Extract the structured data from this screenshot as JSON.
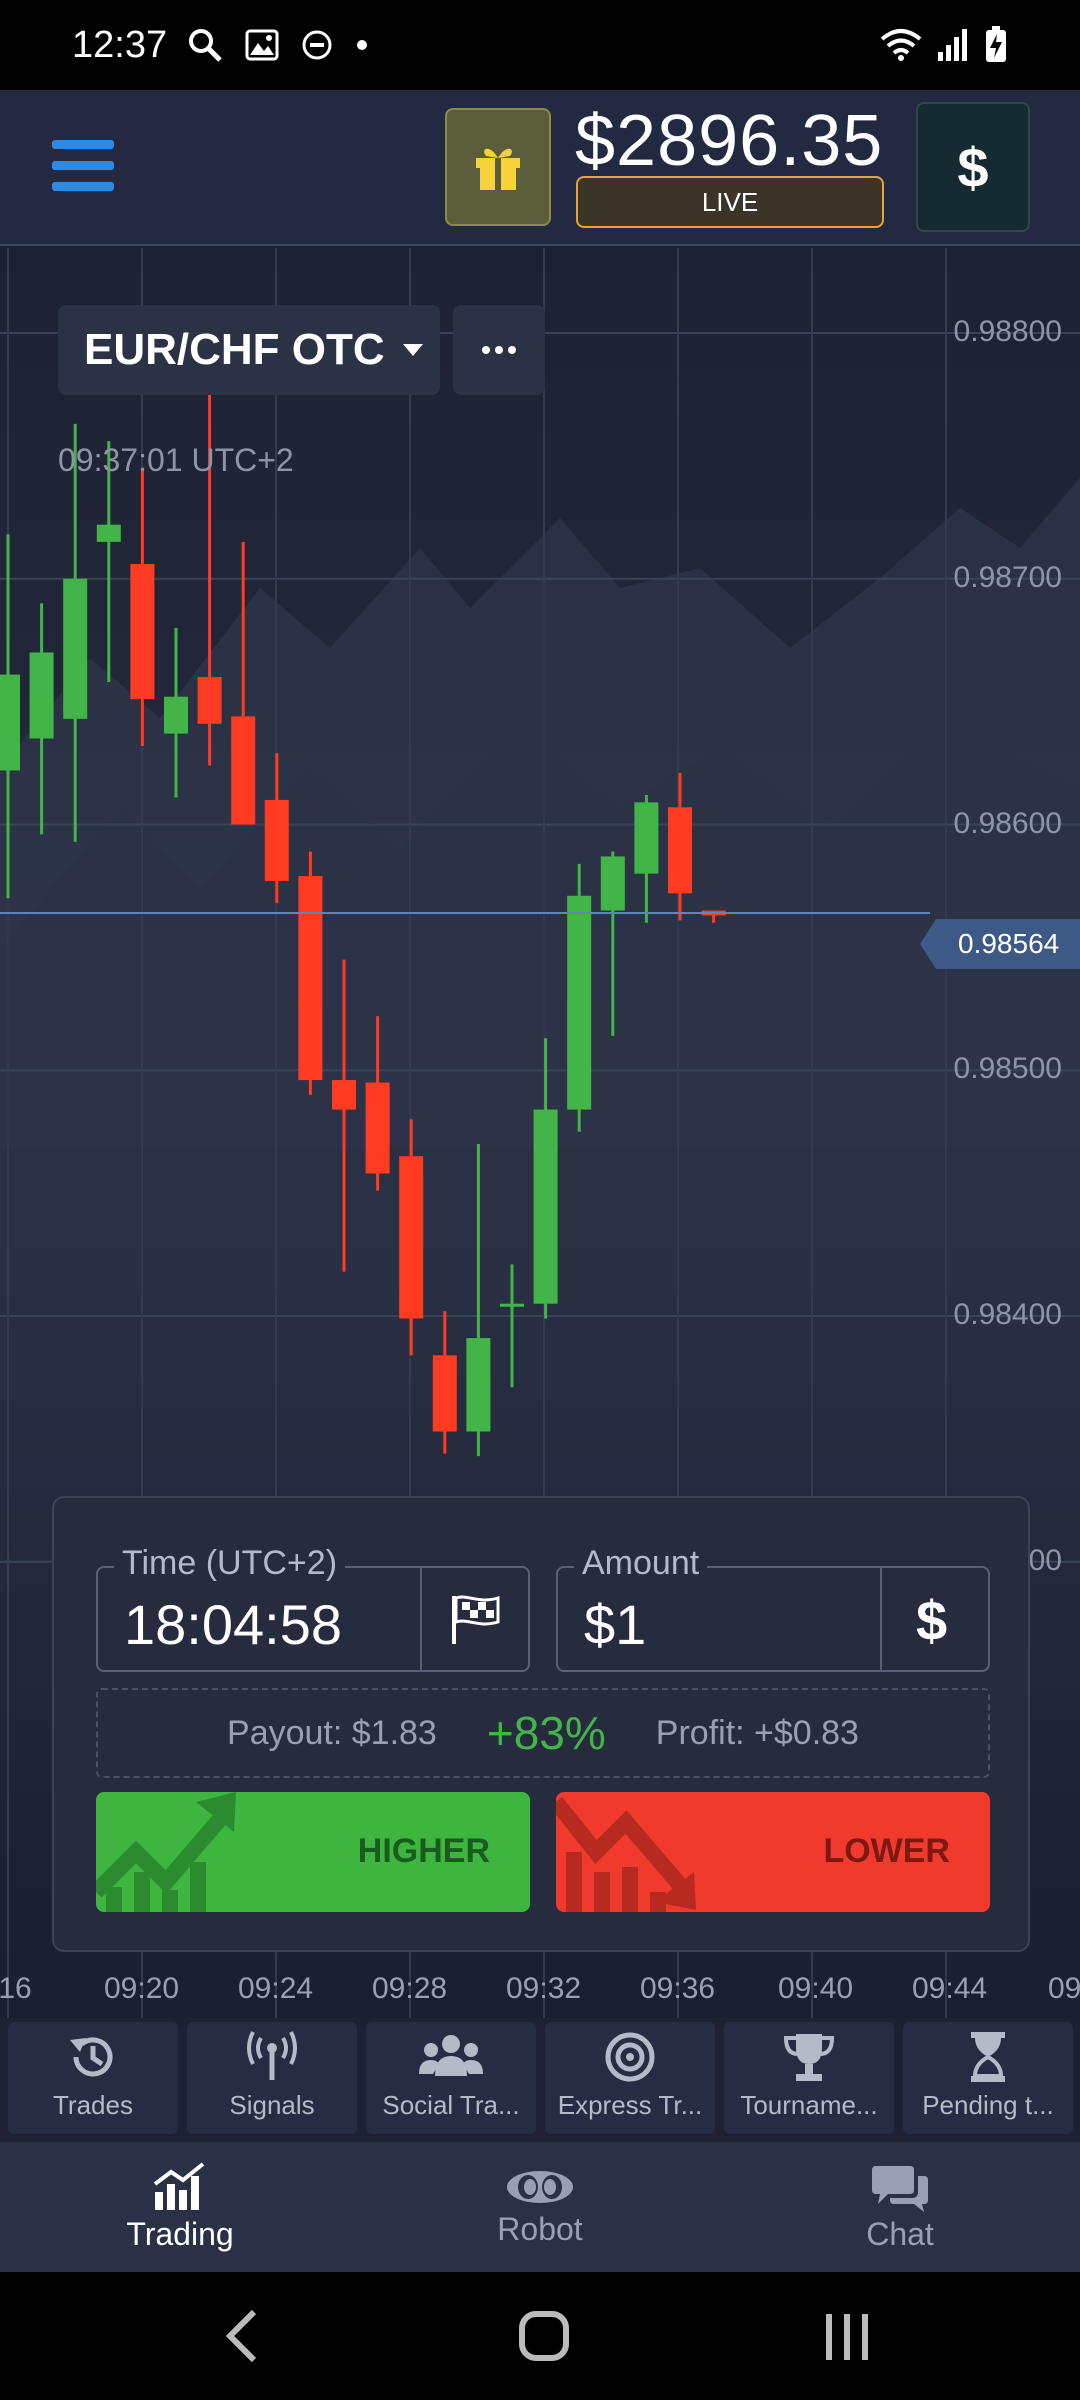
{
  "status_bar": {
    "time": "12:37",
    "icons": [
      "search-icon",
      "image-icon",
      "dnd-icon",
      "dot-icon"
    ],
    "right_icons": [
      "wifi-icon",
      "signal-icon",
      "battery-charging-icon"
    ]
  },
  "header": {
    "balance": "$2896.35",
    "account_mode": "LIVE",
    "currency_symbol": "$"
  },
  "chart": {
    "pair": "EUR/CHF OTC",
    "timestamp": "09:37:01 UTC+2",
    "current_price": "0.98564",
    "price_labels": [
      "0.98800",
      "0.98700",
      "0.98600",
      "0.98500",
      "0.98400",
      "00"
    ],
    "time_labels": [
      ":16",
      "09:20",
      "09:24",
      "09:28",
      "09:32",
      "09:36",
      "09:40",
      "09:44",
      "09"
    ]
  },
  "trade_panel": {
    "time_label": "Time (UTC+2)",
    "time_value": "18:04:58",
    "amount_label": "Amount",
    "amount_value": "$1",
    "amount_currency": "$",
    "payout": "Payout: $1.83",
    "payout_percent": "+83%",
    "profit": "Profit: +$0.83",
    "higher_label": "HIGHER",
    "lower_label": "LOWER",
    "colors": {
      "higher": "#3db53f",
      "lower": "#f03a2e"
    }
  },
  "tools": [
    {
      "label": "Trades",
      "icon": "history-icon"
    },
    {
      "label": "Signals",
      "icon": "antenna-icon"
    },
    {
      "label": "Social Tra...",
      "icon": "users-icon"
    },
    {
      "label": "Express Tr...",
      "icon": "target-icon"
    },
    {
      "label": "Tourname...",
      "icon": "trophy-icon"
    },
    {
      "label": "Pending t...",
      "icon": "hourglass-icon"
    }
  ],
  "bottom_nav": [
    {
      "label": "Trading",
      "icon": "chart-icon",
      "active": true
    },
    {
      "label": "Robot",
      "icon": "robot-icon",
      "active": false
    },
    {
      "label": "Chat",
      "icon": "chat-icon",
      "active": false
    }
  ],
  "colors": {
    "accent_blue": "#2f8ae3",
    "bull": "#43b548",
    "bear": "#ff3b22",
    "live_border": "#e8a33a"
  },
  "candles": [
    {
      "o": 0.98622,
      "h": 0.98718,
      "l": 0.9857,
      "c": 0.98661
    },
    {
      "o": 0.98635,
      "h": 0.9869,
      "l": 0.98596,
      "c": 0.9867
    },
    {
      "o": 0.98643,
      "h": 0.98763,
      "l": 0.98593,
      "c": 0.987
    },
    {
      "o": 0.98715,
      "h": 0.98756,
      "l": 0.98658,
      "c": 0.98722
    },
    {
      "o": 0.98706,
      "h": 0.98745,
      "l": 0.98632,
      "c": 0.98651
    },
    {
      "o": 0.98637,
      "h": 0.9868,
      "l": 0.98611,
      "c": 0.98652
    },
    {
      "o": 0.9866,
      "h": 0.98782,
      "l": 0.98624,
      "c": 0.98641
    },
    {
      "o": 0.98644,
      "h": 0.98715,
      "l": 0.98617,
      "c": 0.986
    },
    {
      "o": 0.9861,
      "h": 0.98629,
      "l": 0.98568,
      "c": 0.98577
    },
    {
      "o": 0.98579,
      "h": 0.98589,
      "l": 0.9849,
      "c": 0.98496
    },
    {
      "o": 0.98496,
      "h": 0.98545,
      "l": 0.98418,
      "c": 0.98484
    },
    {
      "o": 0.98495,
      "h": 0.98522,
      "l": 0.98451,
      "c": 0.98458
    },
    {
      "o": 0.98465,
      "h": 0.9848,
      "l": 0.98384,
      "c": 0.98399
    },
    {
      "o": 0.98384,
      "h": 0.98402,
      "l": 0.98344,
      "c": 0.98353
    },
    {
      "o": 0.98353,
      "h": 0.9847,
      "l": 0.98343,
      "c": 0.98391
    },
    {
      "o": 0.98405,
      "h": 0.98421,
      "l": 0.98371,
      "c": 0.98405
    },
    {
      "o": 0.98405,
      "h": 0.98513,
      "l": 0.98399,
      "c": 0.98484
    },
    {
      "o": 0.98484,
      "h": 0.98584,
      "l": 0.98475,
      "c": 0.98571
    },
    {
      "o": 0.98565,
      "h": 0.98589,
      "l": 0.98514,
      "c": 0.98587
    },
    {
      "o": 0.9858,
      "h": 0.98612,
      "l": 0.9856,
      "c": 0.98609
    },
    {
      "o": 0.98607,
      "h": 0.98621,
      "l": 0.98561,
      "c": 0.98572
    },
    {
      "o": 0.98565,
      "h": 0.98565,
      "l": 0.9856,
      "c": 0.98563
    }
  ]
}
